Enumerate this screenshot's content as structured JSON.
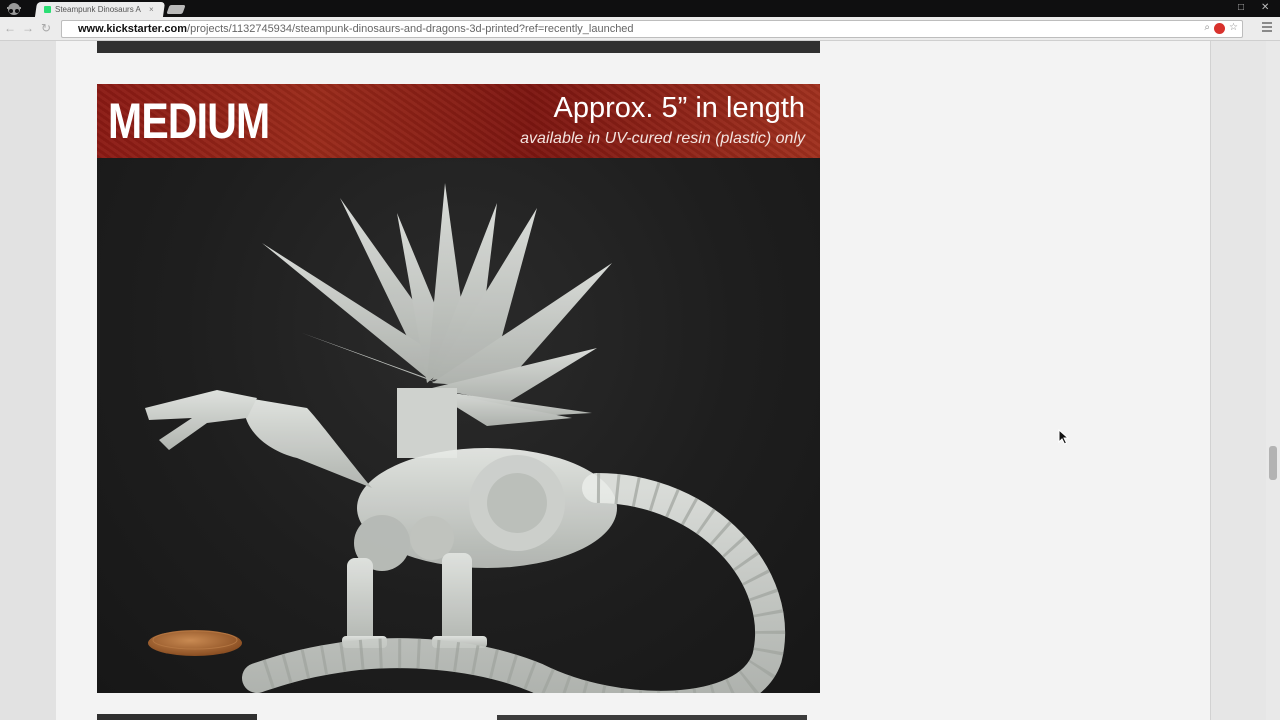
{
  "browser": {
    "tab": {
      "title": "Steampunk Dinosaurs A",
      "close": "×"
    },
    "url": {
      "host": "www.kickstarter.com",
      "path": "/projects/1132745934/steampunk-dinosaurs-and-dragons-3d-printed?ref=recently_launched"
    },
    "icons": [
      "back-icon",
      "forward-icon",
      "reload-icon",
      "search-icon",
      "adblock-icon",
      "star-icon",
      "menu-icon"
    ]
  },
  "page": {
    "hero_image": {
      "size_label": "MEDIUM",
      "length_text": "Approx. 5” in length",
      "material_text": "available in UV-cured resin (plastic) only",
      "banner_color": "#8b1a14"
    }
  },
  "colors": {
    "kickstarter_green": "#2bde73",
    "page_background": "#f3f3f3",
    "chrome_dark": "#0f0f10"
  }
}
